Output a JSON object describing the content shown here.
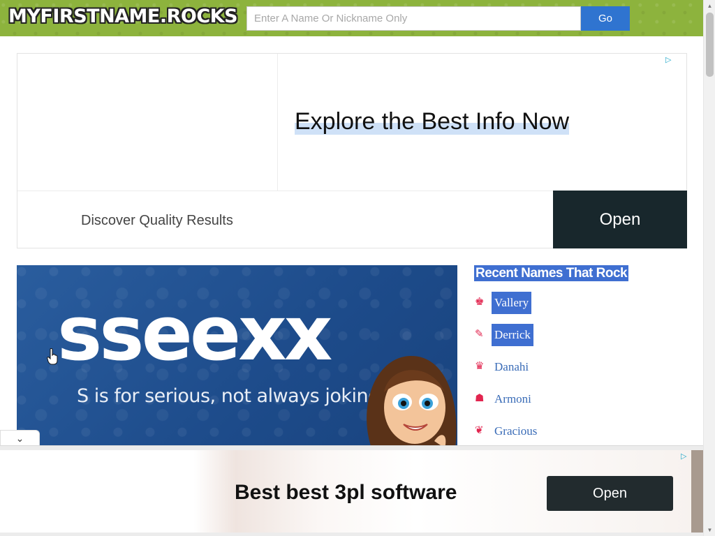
{
  "header": {
    "logo_text": "MYFIRSTNAME.ROCKS",
    "search_placeholder": "Enter A Name Or Nickname Only",
    "go_label": "Go"
  },
  "top_ad": {
    "headline": "Explore the Best Info Now",
    "subline": "Discover Quality Results",
    "open_label": "Open",
    "choices_icon": "ad-choices-icon"
  },
  "hero": {
    "title": "sseexx",
    "tagline": "S is for serious, not always joking."
  },
  "sidebar": {
    "title": "Recent Names That Rock",
    "names": [
      {
        "label": "Vallery",
        "icon": "chess-icon",
        "glyph": "♚"
      },
      {
        "label": "Derrick",
        "icon": "brush-icon",
        "glyph": "✎"
      },
      {
        "label": "Danahi",
        "icon": "crown-icon",
        "glyph": "♛"
      },
      {
        "label": "Armoni",
        "icon": "person-icon",
        "glyph": "☗"
      },
      {
        "label": "Gracious",
        "icon": "bird-icon",
        "glyph": "❦"
      }
    ]
  },
  "bottom_ad": {
    "headline": "Best best 3pl software",
    "open_label": "Open"
  },
  "colors": {
    "header_green": "#8db33d",
    "go_blue": "#2f74d0",
    "hero_blue": "#1f4f8f",
    "link_blue": "#3a6cb7",
    "icon_red": "#e2254f",
    "ad_dark": "#18272c"
  }
}
